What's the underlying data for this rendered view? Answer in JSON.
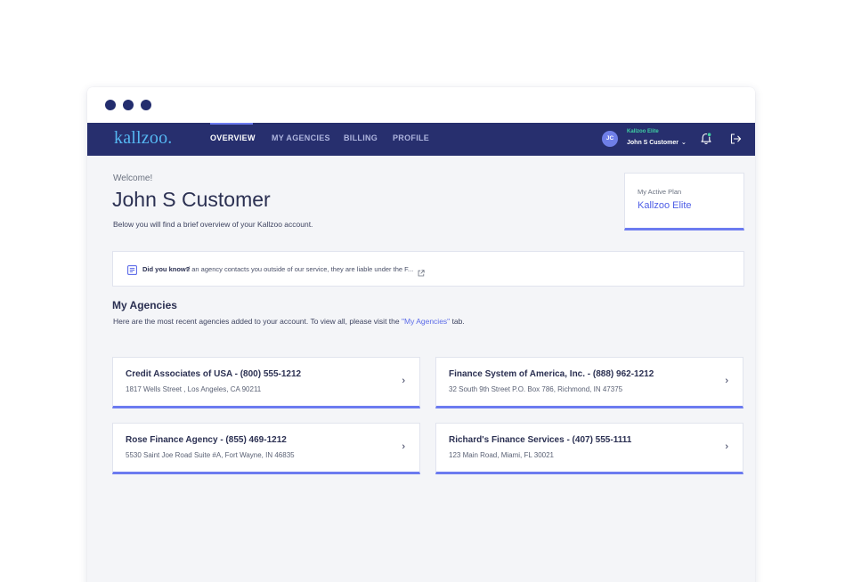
{
  "window": {
    "dots": [
      "close",
      "minimize",
      "maximize"
    ]
  },
  "navbar": {
    "logo": "kallzoo.",
    "items": [
      {
        "label": "OVERVIEW",
        "active": true
      },
      {
        "label": "MY AGENCIES",
        "active": false
      },
      {
        "label": "BILLING",
        "active": false
      },
      {
        "label": "PROFILE",
        "active": false
      }
    ],
    "user": {
      "initials": "JC",
      "plan": "Kallzoo Elite",
      "name": "John S Customer",
      "menu_icon": "chevron-down-icon"
    },
    "icons": [
      "bell-icon",
      "logout-icon"
    ]
  },
  "header": {
    "welcome": "Welcome!",
    "name": "John S Customer",
    "intro": "Below you will find a brief overview of your Kallzoo account."
  },
  "plan_card": {
    "label": "My Active Plan",
    "value": "Kallzoo Elite"
  },
  "tip": {
    "icon": "news-icon",
    "title": "Did you know?",
    "text": "If an agency contacts you outside of our service, they are liable under the F...",
    "link_icon": "external-link-icon"
  },
  "agencies": {
    "title": "My Agencies",
    "desc_before": "Here are the most recent agencies added to your account. To view all, please visit the ",
    "desc_link": "\"My Agencies\"",
    "desc_after": " tab.",
    "items": [
      {
        "name": "Credit Associates of USA - (800) 555-1212",
        "address": "1817 Wells Street , Los Angeles, CA 90211"
      },
      {
        "name": "Finance System of America, Inc. - (888) 962-1212",
        "address": "32 South 9th Street P.O. Box 786, Richmond, IN 47375"
      },
      {
        "name": "Rose Finance Agency - (855) 469-1212",
        "address": "5530 Saint Joe Road Suite #A, Fort Wayne, IN 46835"
      },
      {
        "name": "Richard's Finance Services - (407) 555-1111",
        "address": "123 Main Road, Miami, FL 30021"
      }
    ],
    "chevron": "›"
  },
  "colors": {
    "navbar": "#272f6e",
    "accent": "#6c7bf0",
    "logo": "#55b7f2",
    "plan_badge": "#3fd0a3",
    "link": "#5b6be8"
  }
}
